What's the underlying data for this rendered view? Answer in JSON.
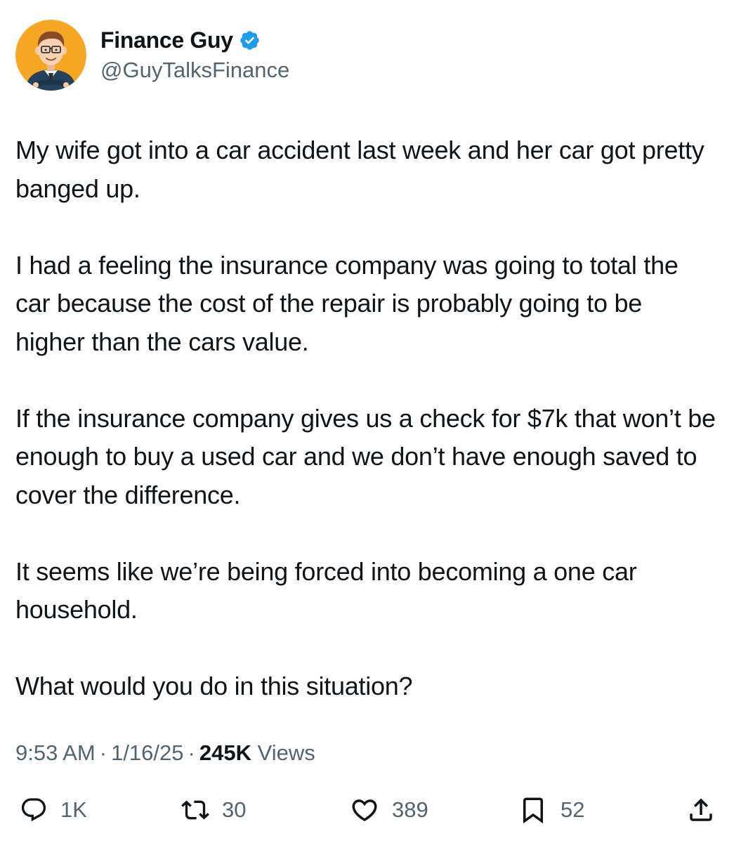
{
  "author": {
    "display_name": "Finance Guy",
    "handle": "@GuyTalksFinance",
    "verified": true,
    "avatar_icon": "cartoon-man-with-glasses-avatar",
    "verified_color": "#1d9bf0"
  },
  "tweet": {
    "paragraphs": [
      "My wife got into a car accident last week and her car got pretty banged up.",
      "I had a feeling the insurance company was going to total the car because the cost of the repair is probably going to be higher than the cars value.",
      "If the insurance company gives us a check for $7k that won’t be enough to buy a used car and we don’t have enough saved to cover the difference.",
      "It seems like we’re being forced into becoming a one car household.",
      "What would you do in this situation?"
    ],
    "time": "9:53 AM",
    "date": "1/16/25",
    "views_count": "245K",
    "views_label": "Views",
    "separator": "·"
  },
  "actions": {
    "replies": {
      "icon": "reply-icon",
      "count": "1K"
    },
    "reposts": {
      "icon": "repost-icon",
      "count": "30"
    },
    "likes": {
      "icon": "heart-icon",
      "count": "389"
    },
    "bookmarks": {
      "icon": "bookmark-icon",
      "count": "52"
    },
    "share": {
      "icon": "share-icon"
    }
  },
  "colors": {
    "text_primary": "#0f1419",
    "text_secondary": "#536471",
    "avatar_background": "#f5a623"
  }
}
